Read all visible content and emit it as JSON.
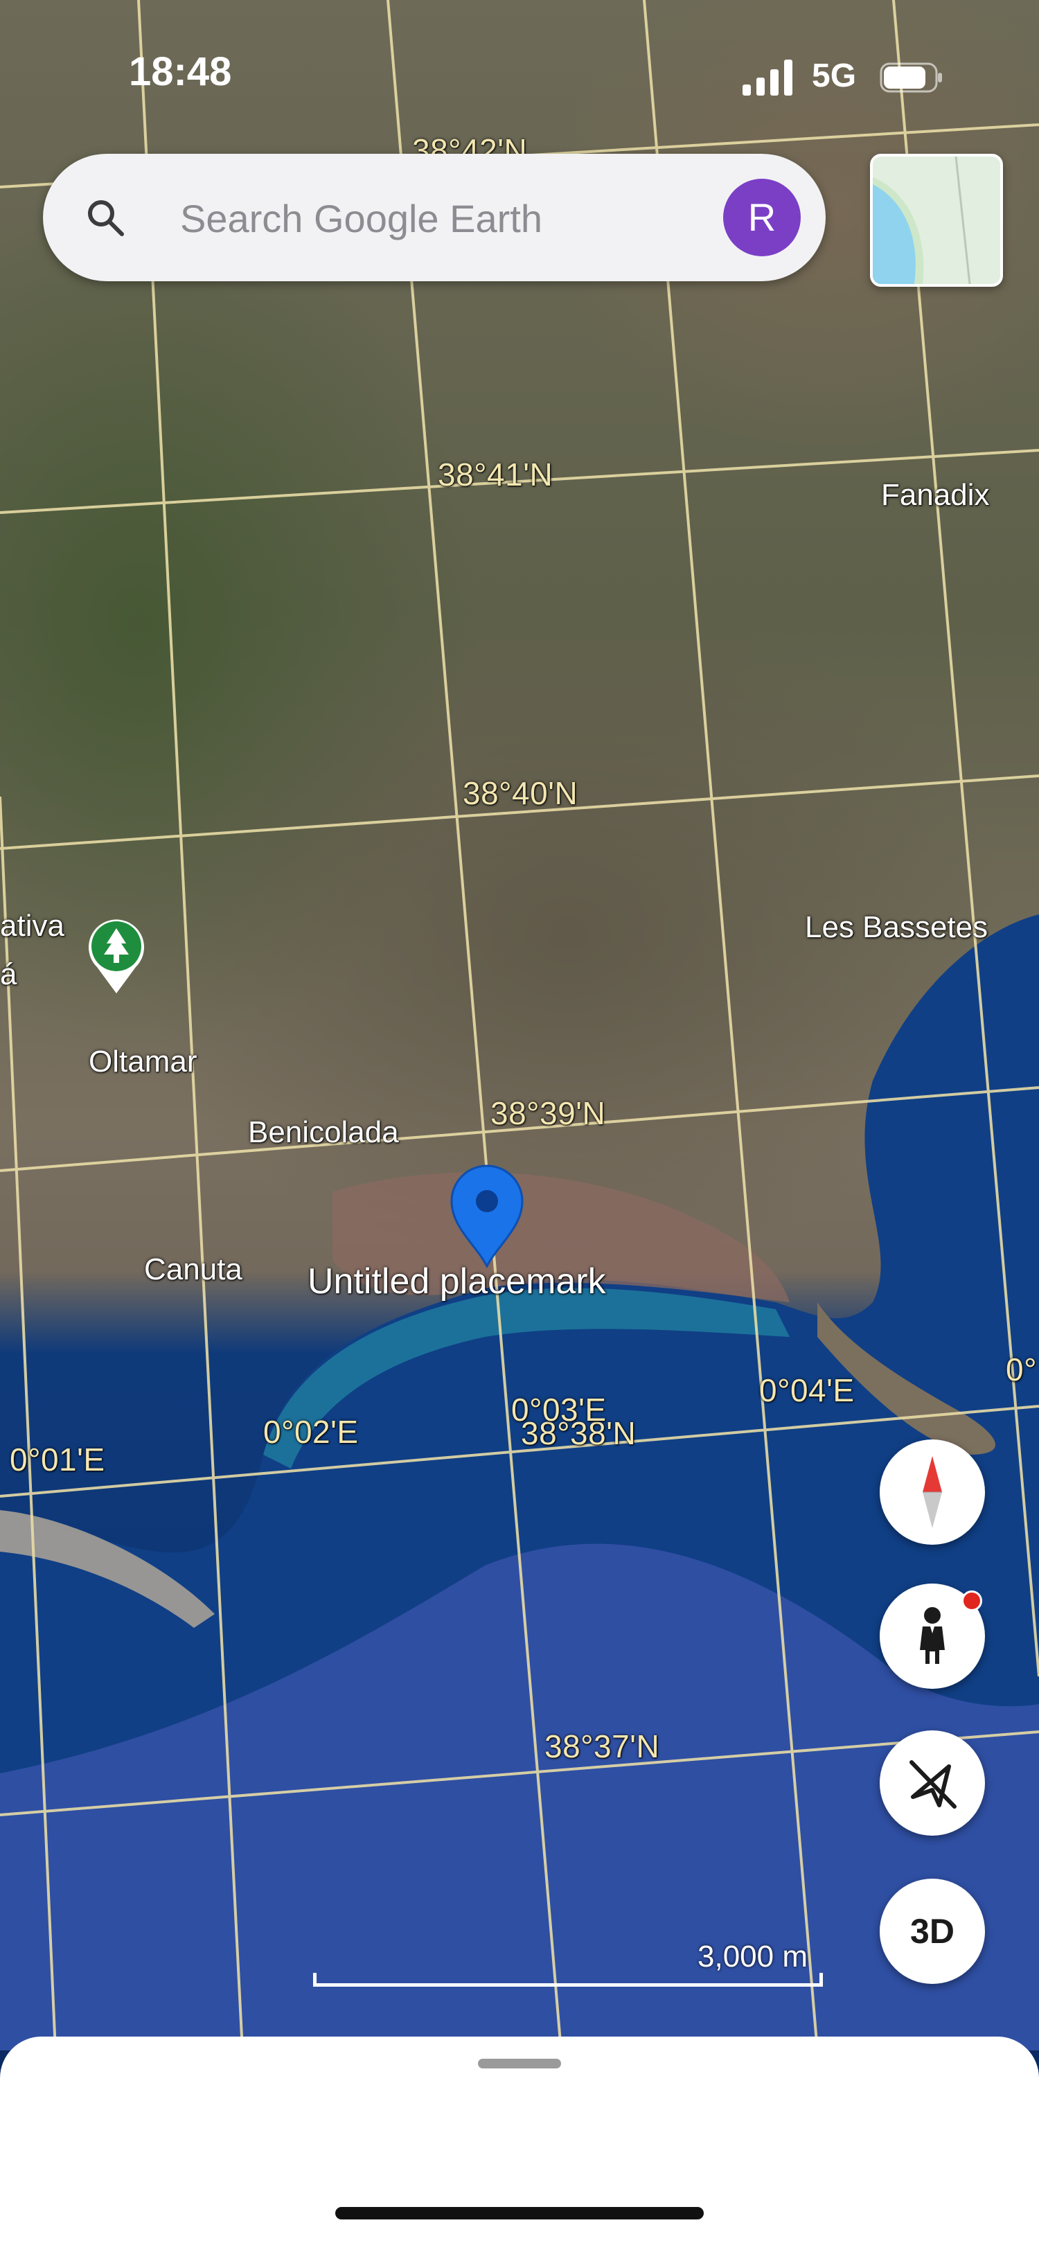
{
  "status_bar": {
    "time": "18:48",
    "network": "5G"
  },
  "search": {
    "placeholder": "Search Google Earth",
    "avatar_initial": "R"
  },
  "map": {
    "latitude_labels": [
      "38°42'N",
      "38°41'N",
      "38°40'N",
      "38°39'N",
      "38°38'N",
      "38°37'N"
    ],
    "longitude_labels": [
      "0°01'E",
      "0°02'E",
      "0°03'E",
      "0°04'E",
      "0°"
    ],
    "places": [
      "Fanadix",
      "Les Bassetes",
      "Oltamar",
      "Benicolada",
      "Canuta",
      "ativa",
      "á"
    ],
    "placemark_label": "Untitled placemark",
    "scale_label": "3,000 m"
  },
  "controls": {
    "three_d_label": "3D"
  },
  "colors": {
    "placemark": "#1a73e8",
    "avatar": "#7b3fc6",
    "grid": "#e8dca6",
    "notification_dot": "#e0261f"
  }
}
